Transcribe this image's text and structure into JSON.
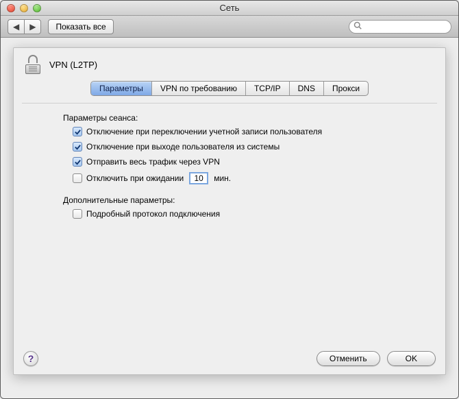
{
  "window": {
    "title": "Сеть"
  },
  "toolbar": {
    "show_all_label": "Показать все",
    "search_placeholder": ""
  },
  "sheet": {
    "title": "VPN (L2TP)",
    "tabs": [
      {
        "label": "Параметры",
        "active": true
      },
      {
        "label": "VPN по требованию",
        "active": false
      },
      {
        "label": "TCP/IP",
        "active": false
      },
      {
        "label": "DNS",
        "active": false
      },
      {
        "label": "Прокси",
        "active": false
      }
    ],
    "session": {
      "heading": "Параметры сеанса:",
      "disconnect_on_switch_user": {
        "label": "Отключение при переключении учетной записи пользователя",
        "checked": true
      },
      "disconnect_on_logout": {
        "label": "Отключение при выходе пользователя из системы",
        "checked": true
      },
      "send_all_traffic": {
        "label": "Отправить весь трафик через VPN",
        "checked": true
      },
      "disconnect_idle": {
        "prefix": "Отключить при ожидании",
        "value": "10",
        "suffix": "мин.",
        "checked": false
      }
    },
    "advanced": {
      "heading": "Дополнительные параметры:",
      "verbose_log": {
        "label": "Подробный протокол подключения",
        "checked": false
      }
    },
    "buttons": {
      "cancel": "Отменить",
      "ok": "OK"
    }
  }
}
